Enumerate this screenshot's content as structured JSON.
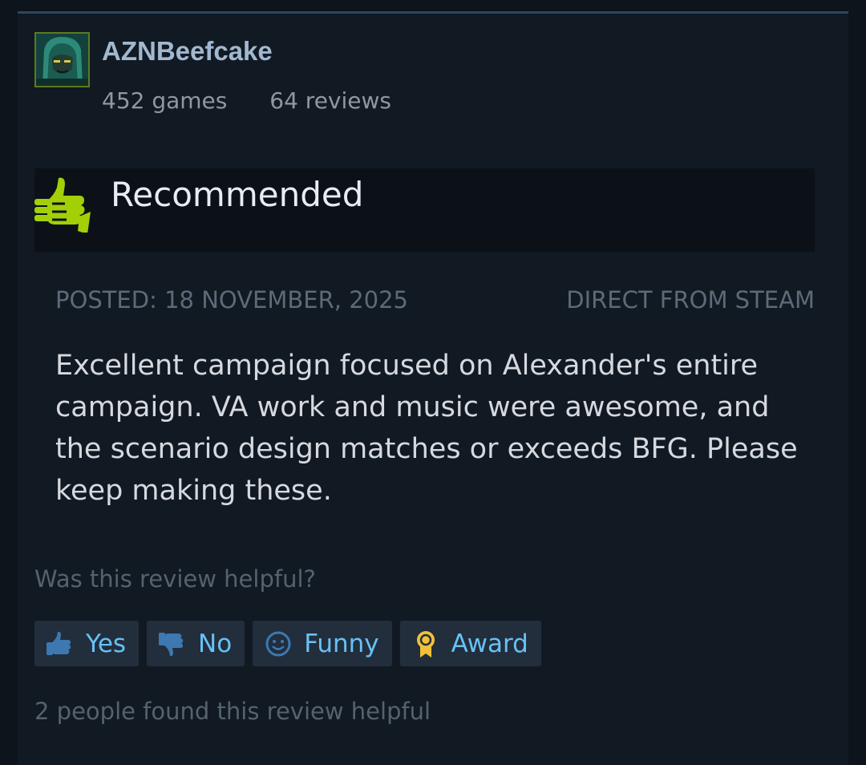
{
  "author": {
    "name": "AZNBeefcake",
    "games": "452 games",
    "reviews": "64 reviews"
  },
  "verdict": {
    "label": "Recommended",
    "icon": "thumbs-up-icon",
    "color": "#a3cf06"
  },
  "meta": {
    "posted": "POSTED: 18 NOVEMBER, 2025",
    "source": "DIRECT FROM STEAM"
  },
  "review": {
    "text": "Excellent campaign focused on Alexander's entire campaign. VA work and music were awesome, and the scenario design matches or exceeds BFG. Please keep making these."
  },
  "feedback": {
    "question": "Was this review helpful?",
    "buttons": {
      "yes": "Yes",
      "no": "No",
      "funny": "Funny",
      "award": "Award"
    },
    "helpful_count": "2 people found this review helpful"
  },
  "colors": {
    "accent_link": "#67c1f5",
    "award_gold": "#f2c13a"
  }
}
